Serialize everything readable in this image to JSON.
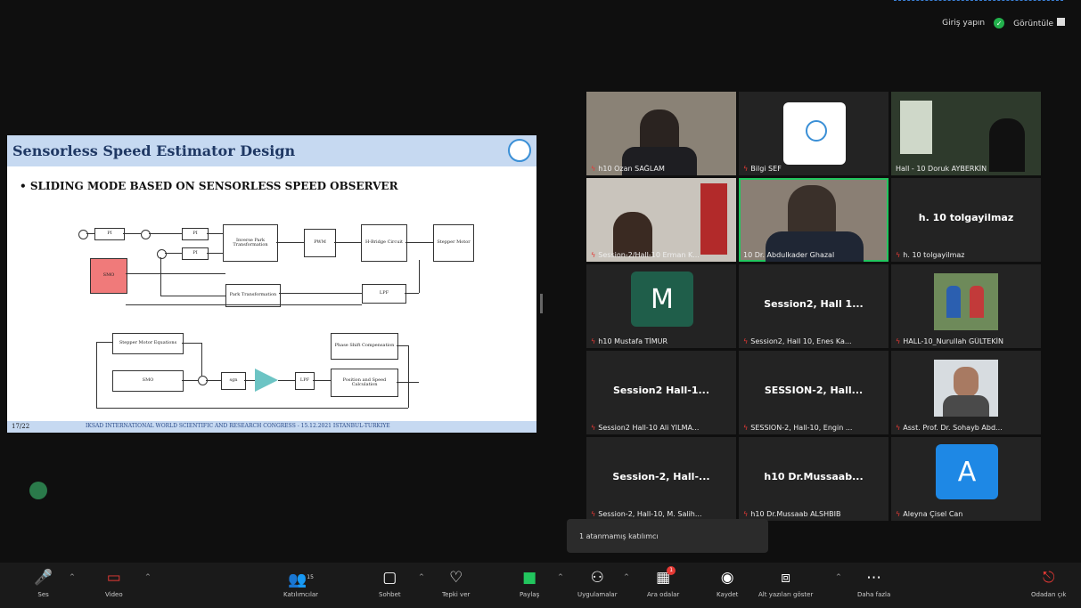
{
  "top": {
    "signin_label": "Giriş yapın",
    "view_label": "Görüntüle"
  },
  "slide": {
    "title": "Sensorless Speed Estimator Design",
    "bullet": "• SLIDING MODE BASED ON SENSORLESS SPEED OBSERVER",
    "page": "17/22",
    "footer": "IKSAD INTERNATIONAL WORLD SCIENTIFIC AND RESEARCH CONGRESS - 15.12.2021 ISTANBUL-TURKIYE",
    "blocks": {
      "pi1": "PI",
      "pi2": "PI",
      "pi3": "PI",
      "inv_park": "Inverse Park Transformation",
      "pwm": "PWM",
      "hbridge": "H-Bridge Circuit",
      "stepper": "Stepper Motor",
      "smo_red": "SMO",
      "park": "Park Transformation",
      "lpf1": "LPF",
      "eq": "Stepper Motor Equations",
      "smo": "SMO",
      "sgn": "sgn",
      "lpf2": "LPF",
      "phase": "Phase Shift Compensation",
      "possp": "Position and Speed Calculation"
    }
  },
  "participants": [
    {
      "name": "h10 Ozan SAĞLAM"
    },
    {
      "name": "Bilgi SEF"
    },
    {
      "name": "Hall - 10 Doruk AYBERKİN"
    },
    {
      "name": "Session-2/Hall-10 Erman K..."
    },
    {
      "name": "10 Dr. Abdulkader Ghazal"
    },
    {
      "name": "h. 10 tolgayilmaz",
      "display": "h. 10 tolgayilmaz"
    },
    {
      "name": "h10 Mustafa TİMUR",
      "initial": "M"
    },
    {
      "name": "Session2, Hall 10, Enes Ka...",
      "display": "Session2, Hall 1..."
    },
    {
      "name": "HALL-10_Nurullah GÜLTEKİN"
    },
    {
      "name": "Session2 Hall-10 Ali YILMA...",
      "display": "Session2 Hall-1..."
    },
    {
      "name": "SESSION-2, Hall-10, Engin ...",
      "display": "SESSION-2, Hall..."
    },
    {
      "name": "Asst. Prof. Dr. Sohayb Abd..."
    },
    {
      "name": "Session-2, Hall-10, M. Salih...",
      "display": "Session-2, Hall-..."
    },
    {
      "name": "h10 Dr.Mussaab ALSHBIB",
      "display": "h10 Dr.Mussaab..."
    },
    {
      "name": "Aleyna Çisel Can",
      "initial": "A"
    }
  ],
  "toast": "1 atanmamış katılımcı",
  "toolbar": {
    "mute": "Ses",
    "video": "Video",
    "participants": "Katılımcılar",
    "participants_count": "15",
    "chat": "Sohbet",
    "react": "Tepki ver",
    "share": "Paylaş",
    "apps": "Uygulamalar",
    "breakout": "Ara odalar",
    "breakout_badge": "1",
    "record": "Kaydet",
    "captions": "Alt yazıları göster",
    "more": "Daha fazla",
    "leave": "Odadan çık"
  },
  "colors": {
    "accent_green": "#22c55e",
    "mic_red": "#e53935",
    "avatar_m": "#1f5e4a",
    "avatar_a": "#1e88e5"
  }
}
